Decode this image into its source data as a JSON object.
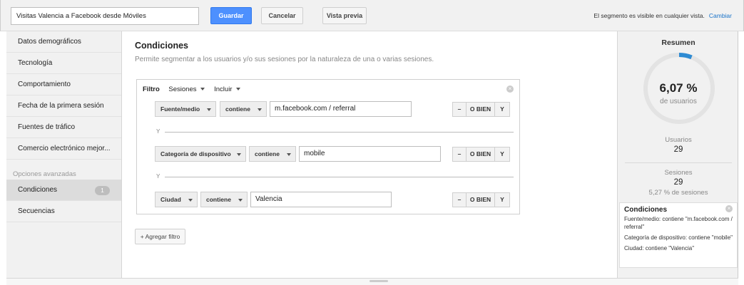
{
  "header": {
    "segment_name": "Visitas Valencia a Facebook desde Móviles",
    "save_label": "Guardar",
    "cancel_label": "Cancelar",
    "preview_label": "Vista previa",
    "visibility_text": "El segmento es visible en cualquier vista.",
    "change_link": "Cambiar"
  },
  "sidebar": {
    "items": [
      {
        "label": "Datos demográficos"
      },
      {
        "label": "Tecnología"
      },
      {
        "label": "Comportamiento"
      },
      {
        "label": "Fecha de la primera sesión"
      },
      {
        "label": "Fuentes de tráfico"
      },
      {
        "label": "Comercio electrónico mejor..."
      }
    ],
    "advanced_title": "Opciones avanzadas",
    "advanced_items": [
      {
        "label": "Condiciones",
        "badge": "1"
      },
      {
        "label": "Secuencias"
      }
    ]
  },
  "main": {
    "title": "Condiciones",
    "subtitle": "Permite segmentar a los usuarios y/o sus sesiones por la naturaleza de una o varias sesiones.",
    "filter": {
      "label": "Filtro",
      "scope": "Sesiones",
      "mode": "Incluir",
      "conditions": [
        {
          "dimension": "Fuente/medio",
          "operator": "contiene",
          "value": "m.facebook.com / referral"
        },
        {
          "dimension": "Categoría de dispositivo",
          "operator": "contiene",
          "value": "mobile"
        },
        {
          "dimension": "Ciudad",
          "operator": "contiene",
          "value": "Valencia"
        }
      ],
      "and_separator": "Y",
      "minus_label": "–",
      "or_label": "O BIEN",
      "and_label": "Y"
    },
    "add_filter_label": "+ Agregar filtro"
  },
  "summary": {
    "title": "Resumen",
    "percent_text": "6,07 %",
    "percent_value": 6.07,
    "percent_caption": "de usuarios",
    "users_label": "Usuarios",
    "users_value": "29",
    "sessions_label": "Sesiones",
    "sessions_value": "29",
    "sessions_pct": "5,27 % de sesiones",
    "conditions_title": "Condiciones",
    "conditions_lines": [
      "Fuente/medio: contiene \"m.facebook.com / referral\"",
      "Categoría de dispositivo: contiene \"mobile\"",
      "Ciudad: contiene \"Valencia\""
    ]
  },
  "colors": {
    "accent": "#4d90fe",
    "donut_fill": "#2e8bd3",
    "donut_track": "#e3e3e3"
  }
}
